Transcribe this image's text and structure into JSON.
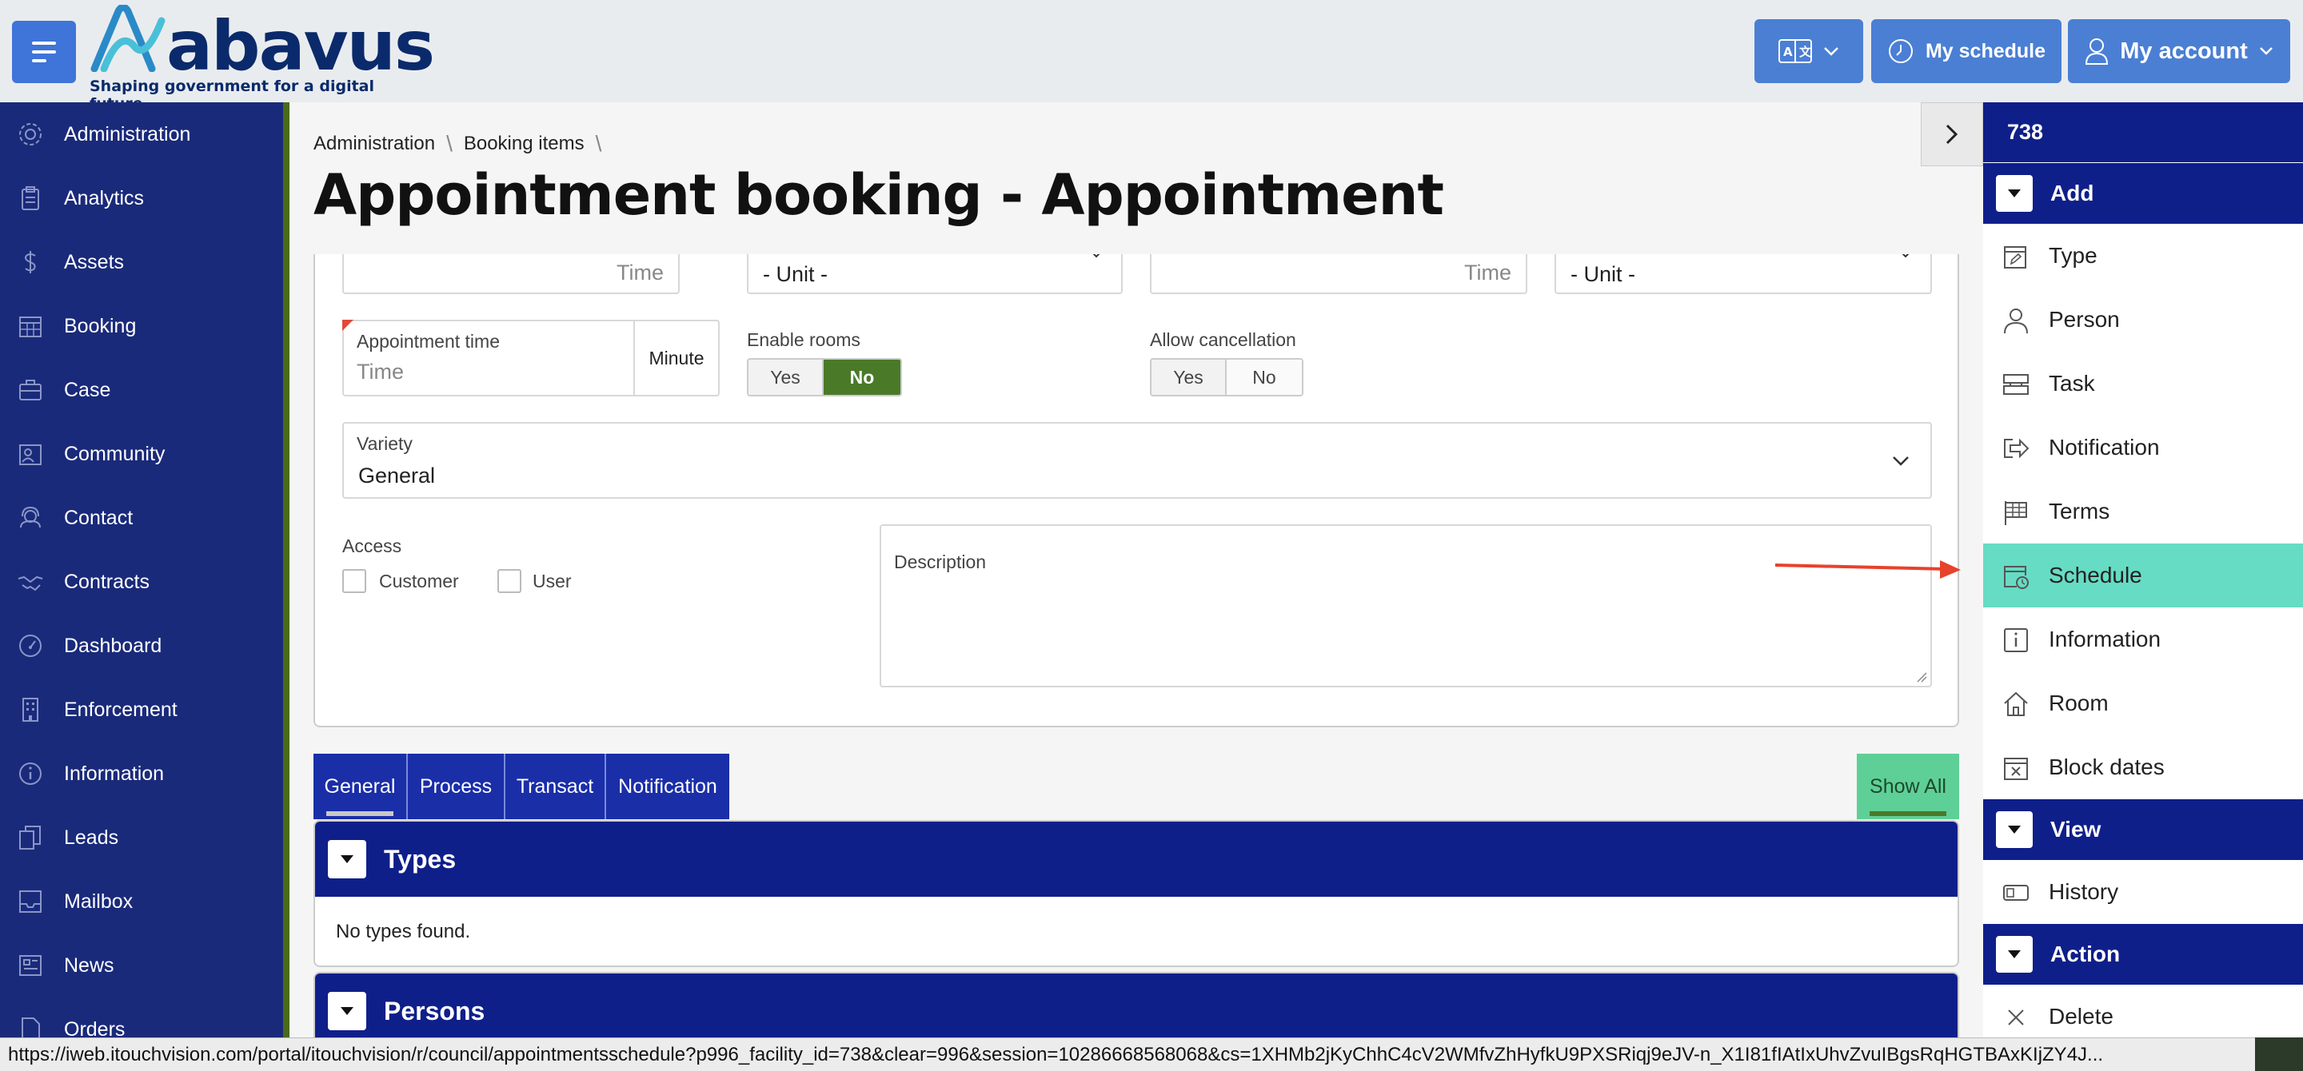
{
  "header": {
    "logo_word": "abavus",
    "logo_tagline": "Shaping government for a digital future",
    "translate_icon": "translate-icon",
    "my_schedule_label": "My schedule",
    "my_account_label": "My account"
  },
  "sidebar": {
    "items": [
      {
        "label": "Administration",
        "icon": "gear-icon"
      },
      {
        "label": "Analytics",
        "icon": "clipboard-icon"
      },
      {
        "label": "Assets",
        "icon": "dollar-icon"
      },
      {
        "label": "Booking",
        "icon": "calendar-icon"
      },
      {
        "label": "Case",
        "icon": "briefcase-icon"
      },
      {
        "label": "Community",
        "icon": "community-icon"
      },
      {
        "label": "Contact",
        "icon": "headset-icon"
      },
      {
        "label": "Contracts",
        "icon": "handshake-icon"
      },
      {
        "label": "Dashboard",
        "icon": "gauge-icon"
      },
      {
        "label": "Enforcement",
        "icon": "building-icon"
      },
      {
        "label": "Information",
        "icon": "info-icon"
      },
      {
        "label": "Leads",
        "icon": "copy-icon"
      },
      {
        "label": "Mailbox",
        "icon": "inbox-icon"
      },
      {
        "label": "News",
        "icon": "newspaper-icon"
      },
      {
        "label": "Orders",
        "icon": "file-icon"
      }
    ]
  },
  "breadcrumb": [
    "Administration",
    "Booking items"
  ],
  "page_title": "Appointment booking - Appointment",
  "form": {
    "row1": {
      "time_placeholder_1": "Time",
      "unit_select_1": "- Unit -",
      "time_placeholder_2": "Time",
      "unit_select_2": "- Unit -"
    },
    "appointment_time": {
      "label": "Appointment time",
      "placeholder": "Time",
      "unit": "Minute"
    },
    "enable_rooms": {
      "label": "Enable rooms",
      "yes": "Yes",
      "no": "No",
      "selected": "No"
    },
    "allow_cancellation": {
      "label": "Allow cancellation",
      "yes": "Yes",
      "no": "No"
    },
    "variety": {
      "label": "Variety",
      "value": "General"
    },
    "access": {
      "label": "Access",
      "options": [
        "Customer",
        "User"
      ]
    },
    "description": {
      "label": "Description"
    }
  },
  "tabs": [
    "General",
    "Process",
    "Transact",
    "Notification"
  ],
  "show_all_label": "Show All",
  "panels": [
    {
      "title": "Types",
      "body": "No types found."
    },
    {
      "title": "Persons",
      "body": ""
    }
  ],
  "right_panel": {
    "id": "738",
    "sections": [
      {
        "title": "Add",
        "items": [
          {
            "label": "Type",
            "icon": "edit-calendar-icon"
          },
          {
            "label": "Person",
            "icon": "person-icon"
          },
          {
            "label": "Task",
            "icon": "task-icon"
          },
          {
            "label": "Notification",
            "icon": "share-icon"
          },
          {
            "label": "Terms",
            "icon": "flag-grid-icon"
          },
          {
            "label": "Schedule",
            "icon": "calendar-clock-icon",
            "active": true
          },
          {
            "label": "Information",
            "icon": "info-box-icon"
          },
          {
            "label": "Room",
            "icon": "home-icon"
          },
          {
            "label": "Block dates",
            "icon": "calendar-x-icon"
          }
        ]
      },
      {
        "title": "View",
        "items": [
          {
            "label": "History",
            "icon": "history-icon"
          }
        ]
      },
      {
        "title": "Action",
        "items": [
          {
            "label": "Delete",
            "icon": "close-icon"
          }
        ]
      }
    ]
  },
  "status_bar_url": "https://iweb.itouchvision.com/portal/itouchvision/r/council/appointmentsschedule?p996_facility_id=738&clear=996&session=10286668568068&cs=1XHMb2jKyChhC4cV2WMfvZhHyfkU9PXSRiqj9eJV-n_X1I81fIAtIxUhvZvuIBgsRqHGTBAxKIjZY4J...",
  "colors": {
    "sidebar_bg": "#1a2a7a",
    "panel_head": "#0f1f8a",
    "accent_blue": "#4a7fd4",
    "active_item": "#66dcc4",
    "toggle_on": "#4a7a28",
    "annotation_arrow": "#e8412c"
  }
}
